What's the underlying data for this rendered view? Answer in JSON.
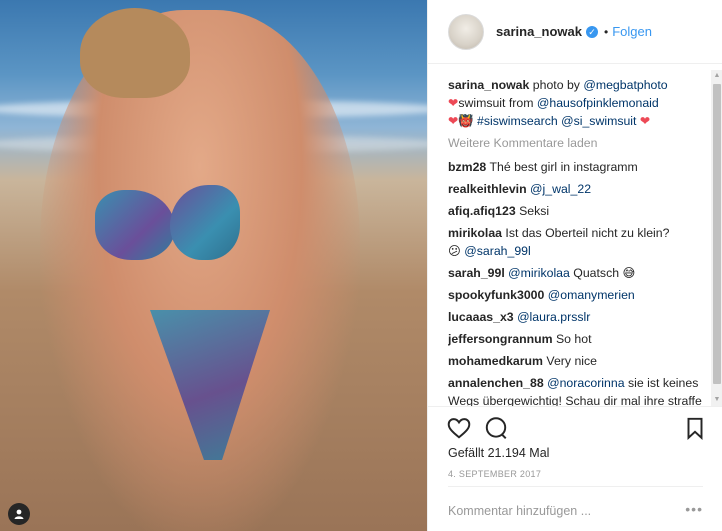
{
  "post": {
    "photo_alt": "",
    "badge_icon": "user-tag-icon"
  },
  "header": {
    "username": "sarina_nowak",
    "verified_icon": "verified-badge-icon",
    "separator": "•",
    "follow_label": "Folgen"
  },
  "caption": {
    "user": "sarina_nowak",
    "text1": " photo by ",
    "mention1": "@megbatphoto",
    "text2": "swimsuit from ",
    "mention2": "@hausofpinklemonaid",
    "hashtag": "#siswimsearch",
    "mention3": "@si_swimsuit"
  },
  "load_more": "Weitere Kommentare laden",
  "comments": [
    {
      "user": "bzm28",
      "text": "Thé best girl in instagramm"
    },
    {
      "user": "realkeithlevin",
      "mention": "@j_wal_22"
    },
    {
      "user": "afiq.afiq123",
      "text": "Seksi"
    },
    {
      "user": "mirikolaa",
      "text": "Ist das Oberteil nicht zu klein?",
      "emoji": "😕",
      "mention": "@sarah_99l"
    },
    {
      "user": "sarah_99l",
      "mention": "@mirikolaa",
      "text": " Quatsch",
      "emoji": "😅"
    },
    {
      "user": "spookyfunk3000",
      "mention": "@omanymerien"
    },
    {
      "user": "lucaaas_x3",
      "mention": "@laura.prsslr"
    },
    {
      "user": "jeffersongrannum",
      "text": "So hot"
    },
    {
      "user": "mohamedkarum",
      "text": "Very nice"
    },
    {
      "user": "annalenchen_88",
      "mention": "@noracorinna",
      "text": " sie ist keines Wegs übergewichtig! Schau dir mal ihre straffe Haut an. Wenn das Fett"
    }
  ],
  "actions": {
    "like_icon": "heart-icon",
    "comment_icon": "comment-icon",
    "save_icon": "bookmark-icon"
  },
  "likes": "Gefällt 21.194 Mal",
  "date": "4. SEPTEMBER 2017",
  "add_comment": {
    "placeholder": "Kommentar hinzufügen ...",
    "more_label": "•••"
  }
}
